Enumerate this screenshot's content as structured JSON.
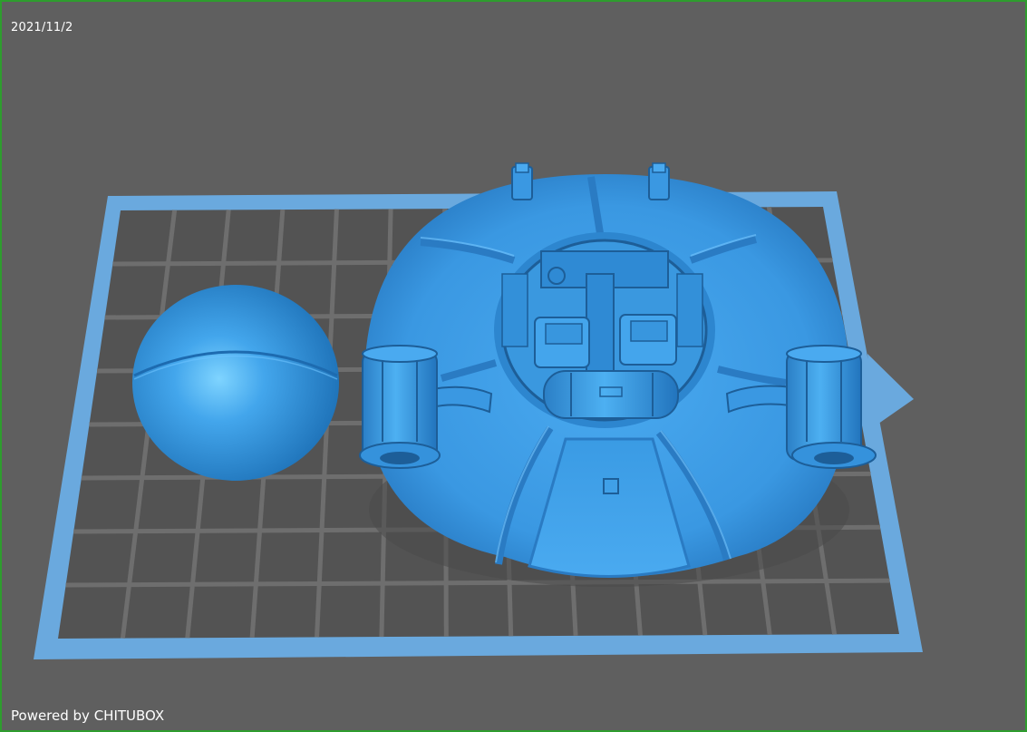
{
  "viewport": {
    "date": "2021/11/2",
    "footer": "Powered by CHITUBOX"
  },
  "colors": {
    "background": "#5f5f5f",
    "frame_border": "#2e9d2e",
    "build_plate": "#6aa9de",
    "model_blue": "#3f9de6",
    "model_dark": "#1f6fb4",
    "grid_lines": "#6e6e6e"
  },
  "models": [
    {
      "name": "sphere-model"
    },
    {
      "name": "saucer-model"
    }
  ]
}
